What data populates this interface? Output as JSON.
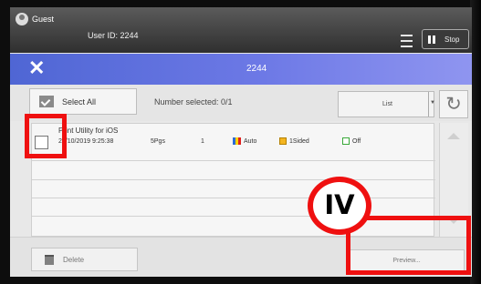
{
  "topbar": {
    "guest_label": "Guest",
    "user_id": "User ID: 2244",
    "stop_label": "Stop"
  },
  "titlebar": {
    "title": "2244"
  },
  "toolbar": {
    "select_all_label": "Select All",
    "number_selected": "Number selected: 0/1",
    "view_label": "List"
  },
  "jobs": [
    {
      "name": "Print Utility for iOS",
      "date": "21/10/2019 9:25:38",
      "pages": "5Pgs",
      "copies": "1",
      "color": "Auto",
      "sided": "1Sided",
      "staple": "Off"
    }
  ],
  "footer": {
    "delete_label": "Delete",
    "preview_label": "Preview..."
  },
  "annotation": {
    "badge": "IV",
    "color": "#ef1010"
  },
  "colors": {
    "header_blue": "#5f70dc",
    "topbar_dark": "#3a3a3a"
  }
}
